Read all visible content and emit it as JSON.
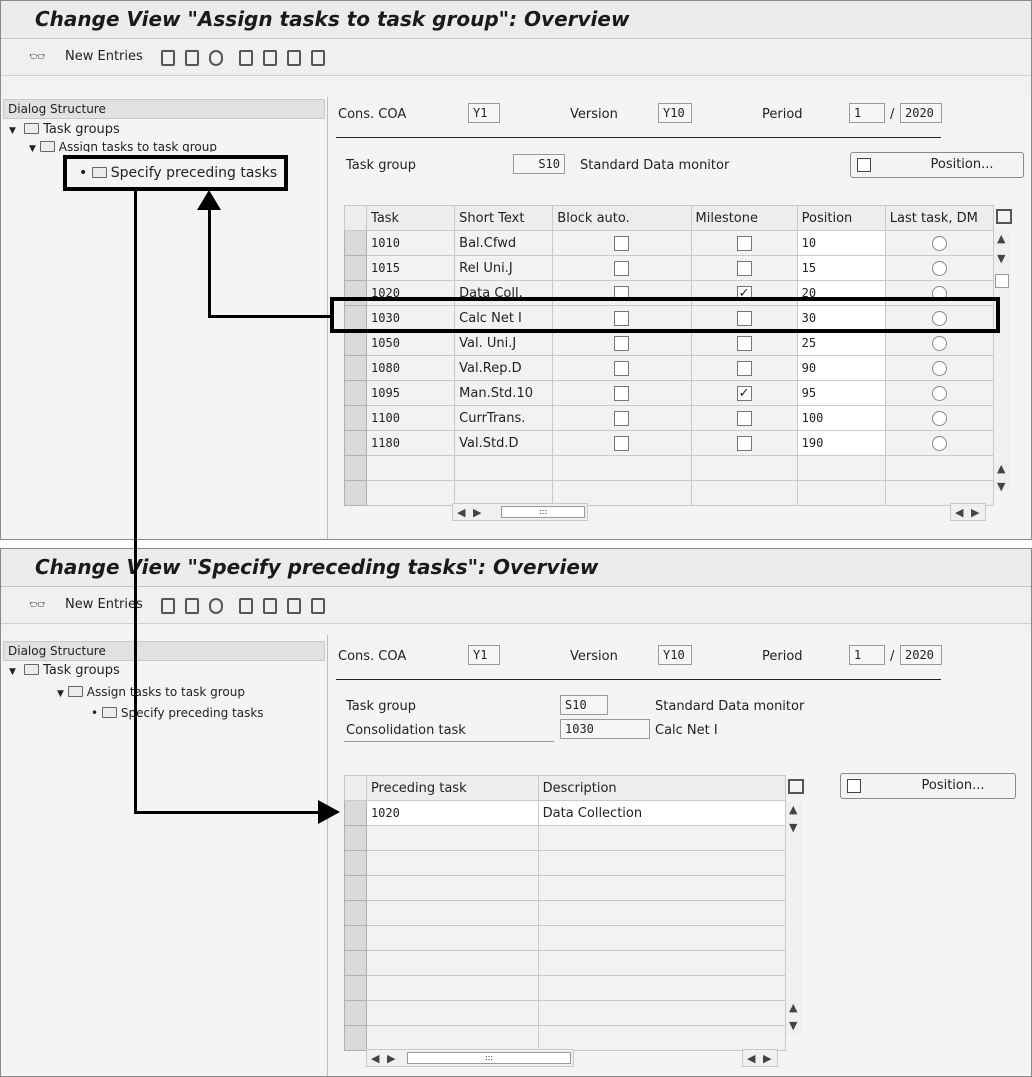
{
  "top": {
    "title": "Change View \"Assign tasks to task group\": Overview",
    "toolbar": {
      "new_entries": "New Entries"
    },
    "dialog_structure": "Dialog Structure",
    "tree": [
      "Task groups",
      "Assign tasks to task group",
      "Specify preceding tasks"
    ],
    "header": {
      "cons_coa_label": "Cons. COA",
      "cons_coa_value": "Y1",
      "version_label": "Version",
      "version_value": "Y10",
      "period_label": "Period",
      "period_value": "1",
      "year_value": "2020",
      "slash": "/"
    },
    "task_group_label": "Task group",
    "task_group_value": "S10",
    "task_group_text": "Standard Data monitor",
    "position_button": "Position...",
    "columns": [
      "Task",
      "Short Text",
      "Block auto.",
      "Milestone",
      "Position",
      "Last task, DM"
    ],
    "rows": [
      {
        "task": "1010",
        "short": "Bal.Cfwd",
        "block": false,
        "milestone": false,
        "position": "10"
      },
      {
        "task": "1015",
        "short": "Rel Uni.J",
        "block": false,
        "milestone": false,
        "position": "15"
      },
      {
        "task": "1020",
        "short": "Data Coll.",
        "block": false,
        "milestone": true,
        "position": "20"
      },
      {
        "task": "1030",
        "short": "Calc Net I",
        "block": false,
        "milestone": false,
        "position": "30"
      },
      {
        "task": "1050",
        "short": "Val. Uni.J",
        "block": false,
        "milestone": false,
        "position": "25"
      },
      {
        "task": "1080",
        "short": "Val.Rep.D",
        "block": false,
        "milestone": false,
        "position": "90"
      },
      {
        "task": "1095",
        "short": "Man.Std.10",
        "block": false,
        "milestone": true,
        "position": "95"
      },
      {
        "task": "1100",
        "short": "CurrTrans.",
        "block": false,
        "milestone": false,
        "position": "100"
      },
      {
        "task": "1180",
        "short": "Val.Std.D",
        "block": false,
        "milestone": false,
        "position": "190"
      }
    ]
  },
  "bottom": {
    "title": "Change View \"Specify preceding tasks\": Overview",
    "toolbar": {
      "new_entries": "New Entries"
    },
    "dialog_structure": "Dialog Structure",
    "tree": [
      "Task groups",
      "Assign tasks to task group",
      "Specify preceding tasks"
    ],
    "header": {
      "cons_coa_label": "Cons. COA",
      "cons_coa_value": "Y1",
      "version_label": "Version",
      "version_value": "Y10",
      "period_label": "Period",
      "period_value": "1",
      "year_value": "2020",
      "slash": "/"
    },
    "task_group_label": "Task group",
    "task_group_value": "S10",
    "task_group_text": "Standard Data monitor",
    "cons_task_label": "Consolidation task",
    "cons_task_value": "1030",
    "cons_task_text": "Calc Net I",
    "position_button": "Position...",
    "columns": [
      "Preceding task",
      "Description"
    ],
    "rows": [
      {
        "task": "1020",
        "desc": "Data Collection"
      }
    ]
  },
  "glyphs": {
    "check": "✓",
    "up": "▲",
    "down": "▼",
    "left": "◀",
    "right": "▶",
    "grip": ":::"
  }
}
